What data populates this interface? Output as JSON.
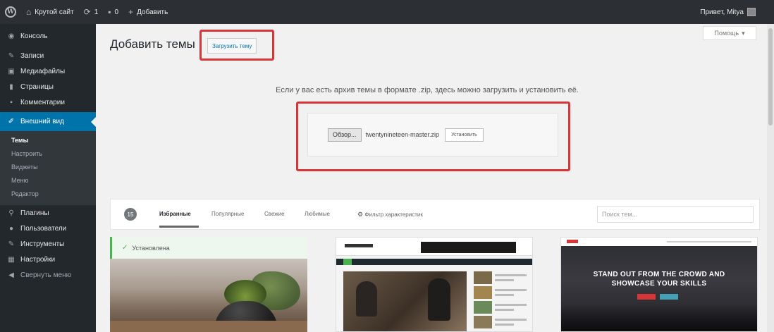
{
  "adminbar": {
    "site_name": "Крутой сайт",
    "updates_count": "1",
    "comments_count": "0",
    "add_new": "Добавить",
    "greeting": "Привет, Mitya"
  },
  "sidebar": {
    "items": [
      {
        "label": "Консоль",
        "icon": "dashboard-icon"
      },
      {
        "label": "Записи",
        "icon": "pin-icon"
      },
      {
        "label": "Медиафайлы",
        "icon": "media-icon"
      },
      {
        "label": "Страницы",
        "icon": "page-icon"
      },
      {
        "label": "Комментарии",
        "icon": "comment-icon"
      },
      {
        "label": "Внешний вид",
        "icon": "brush-icon"
      },
      {
        "label": "Плагины",
        "icon": "plug-icon"
      },
      {
        "label": "Пользователи",
        "icon": "user-icon"
      },
      {
        "label": "Инструменты",
        "icon": "wrench-icon"
      },
      {
        "label": "Настройки",
        "icon": "settings-icon"
      },
      {
        "label": "Свернуть меню",
        "icon": "collapse-icon"
      }
    ],
    "submenu": [
      "Темы",
      "Настроить",
      "Виджеты",
      "Меню",
      "Редактор"
    ]
  },
  "main": {
    "help_label": "Помощь",
    "page_title": "Добавить темы",
    "upload_theme_button": "Загрузить тему",
    "upload_instruction": "Если у вас есть архив темы в формате .zip, здесь можно загрузить и установить её.",
    "browse_button": "Обзор...",
    "file_name": "twentynineteen-master.zip",
    "install_button": "Установить"
  },
  "filter": {
    "count": "15",
    "tabs": [
      "Избранные",
      "Популярные",
      "Свежие",
      "Любимые"
    ],
    "feature_filter": "Фильтр характеристик",
    "search_placeholder": "Поиск тем..."
  },
  "themes": {
    "installed_label": "Установлена",
    "card3_headline_1": "STAND OUT FROM THE CROWD AND",
    "card3_headline_2": "SHOWCASE YOUR SKILLS"
  },
  "colors": {
    "admin_bar": "#2c2f33",
    "sidebar": "#23282d",
    "active_menu": "#0073aa",
    "highlight": "#d63638",
    "installed_green": "#46b450"
  }
}
